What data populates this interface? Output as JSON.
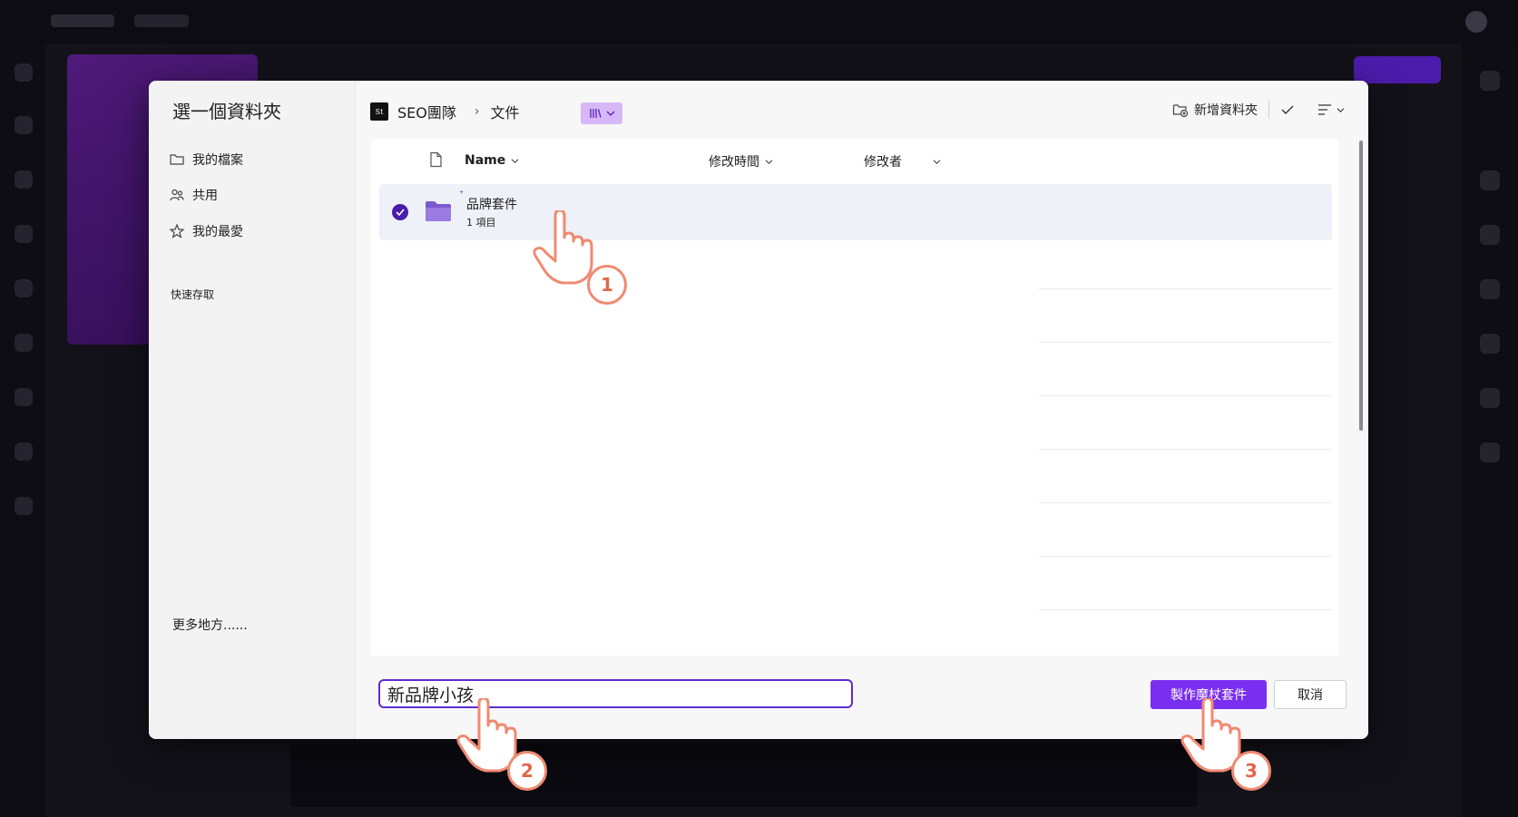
{
  "dialog": {
    "title": "選一個資料夾",
    "sidebar": {
      "items": [
        {
          "label": "我的檔案",
          "icon": "folder-icon"
        },
        {
          "label": "共用",
          "icon": "people-icon"
        },
        {
          "label": "我的最愛",
          "icon": "star-icon"
        }
      ],
      "section": "快速存取",
      "more": "更多地方......"
    },
    "breadcrumb": {
      "site_icon_text": "St",
      "site": "SEO團隊",
      "folder": "文件"
    },
    "toolbar": {
      "new_folder": "新增資料夾"
    },
    "columns": {
      "name": "Name",
      "modified": "修改時間",
      "modified_by": "修改者"
    },
    "rows": [
      {
        "name": "品牌套件",
        "sub": "1 項目",
        "selected": true
      }
    ],
    "footer": {
      "name_value": "新品牌小孩",
      "primary": "製作魔杖套件",
      "cancel": "取消"
    }
  },
  "steps": [
    "1",
    "2",
    "3"
  ],
  "colors": {
    "accent": "#7a2ff0",
    "check": "#4b1cab",
    "badge": "#f08a72"
  }
}
